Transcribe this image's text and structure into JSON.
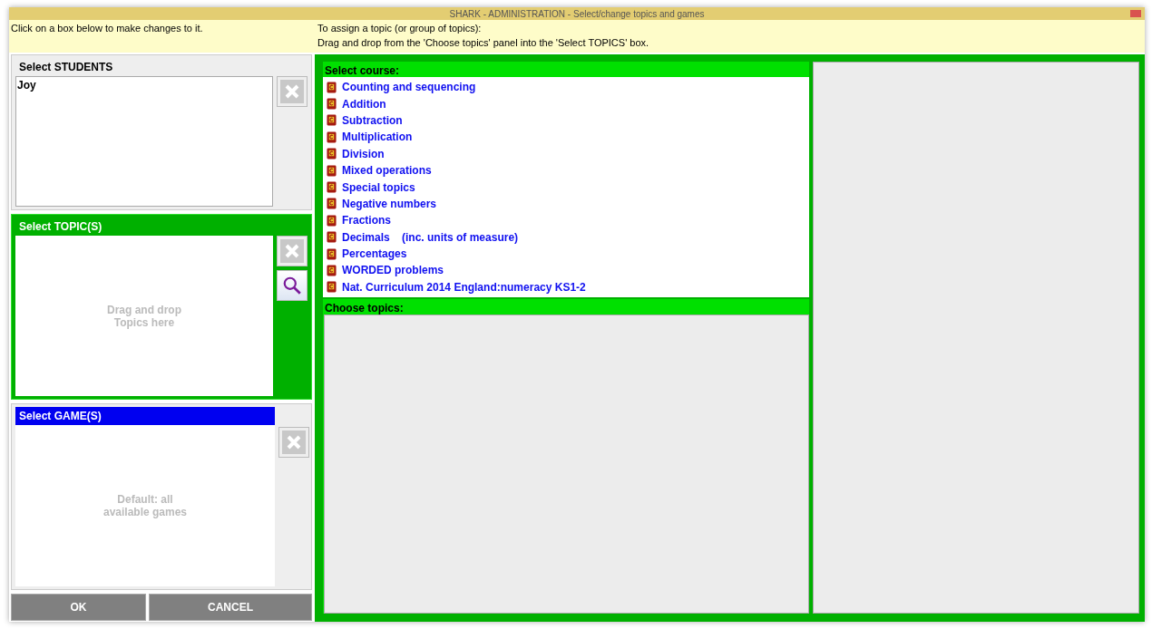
{
  "window": {
    "title": "SHARK - ADMINISTRATION - Select/change topics and games"
  },
  "instructions": {
    "left": "Click on a box below to make changes to it.",
    "right": [
      "To assign a topic (or group of topics):",
      "Drag and drop from the 'Choose topics' panel into the 'Select TOPICS' box."
    ]
  },
  "panels": [
    {
      "kind": "list",
      "title": "Select STUDENTS",
      "active": false,
      "header_selected": false,
      "items": [
        "Joy"
      ],
      "buttons": [
        {
          "kind": "remove"
        }
      ]
    },
    {
      "kind": "drop",
      "title": "Select TOPIC(S)",
      "active": true,
      "header_selected": false,
      "placeholder": [
        "Drag and drop",
        "Topics here"
      ],
      "buttons": [
        {
          "kind": "remove"
        },
        {
          "kind": "search"
        }
      ]
    },
    {
      "kind": "drop",
      "title": "Select GAME(S)",
      "active": false,
      "header_selected": true,
      "placeholder": [
        "Default: all",
        "available games"
      ],
      "buttons": [
        {
          "kind": "remove"
        }
      ]
    }
  ],
  "actions": [
    "OK",
    "CANCEL"
  ],
  "course": {
    "title": "Select course:",
    "items": [
      "Counting and sequencing",
      "Addition",
      "Subtraction",
      "Multiplication",
      "Division",
      "Mixed operations",
      "Special topics",
      "Negative numbers",
      "Fractions",
      "Decimals    (inc. units of measure)",
      "Percentages",
      "WORDED problems",
      "Nat. Curriculum 2014 England:numeracy KS1-2"
    ]
  },
  "topics": {
    "title": "Choose topics:"
  }
}
